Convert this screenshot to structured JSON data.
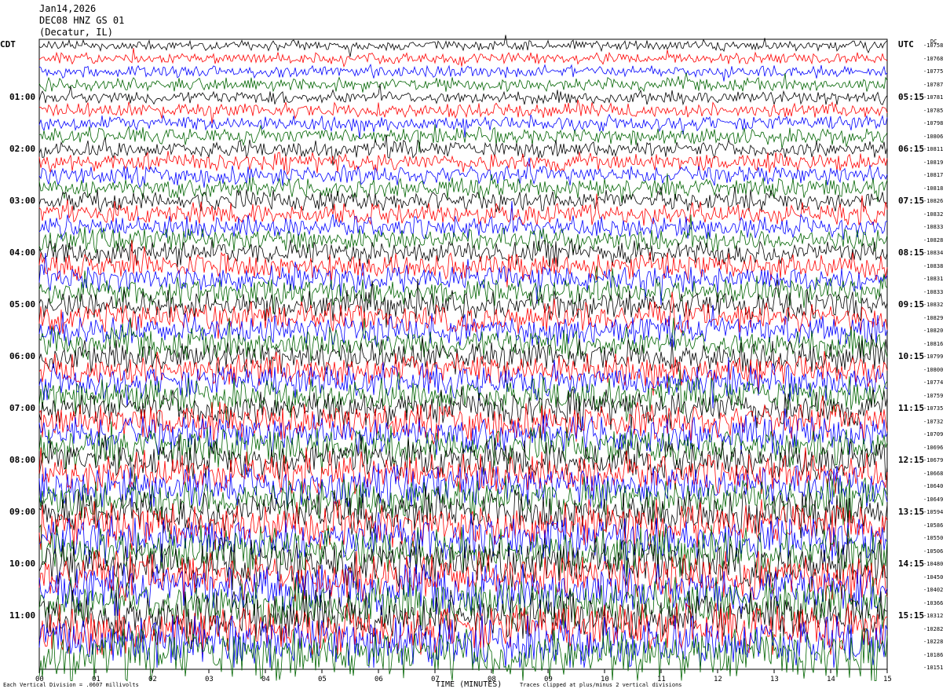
{
  "header": {
    "date": "Jan14,2026",
    "station": "DEC08 HNZ GS 01",
    "location": "(Decatur, IL)"
  },
  "left_axis_title": "CDT",
  "right_axis_title": "UTC",
  "dc_title": "DC",
  "footer": {
    "scale_note": "Each Vertical Division = .0607 millivolts",
    "x_axis_title": "TIME (MINUTES)",
    "clip_note": "Traces clipped at plus/minus 2 vertical divisions"
  },
  "colors": {
    "black": "#000000",
    "red": "#ff0000",
    "blue": "#0000ff",
    "green": "#006400"
  },
  "chart_data": {
    "type": "line",
    "title": "",
    "xlabel": "TIME (MINUTES)",
    "x_ticks": [
      "00",
      "01",
      "02",
      "03",
      "04",
      "05",
      "06",
      "07",
      "08",
      "09",
      "10",
      "11",
      "12",
      "13",
      "14",
      "15"
    ],
    "xlim": [
      0,
      15
    ],
    "trace_minutes": 15,
    "trace_count": 48,
    "trace_color_cycle": [
      "black",
      "red",
      "blue",
      "green"
    ],
    "left_ticks": [
      "01:00",
      "02:00",
      "03:00",
      "04:00",
      "05:00",
      "06:00",
      "07:00",
      "08:00",
      "09:00",
      "10:00",
      "11:00"
    ],
    "right_ticks": [
      "05:15",
      "06:15",
      "07:15",
      "08:15",
      "09:15",
      "10:15",
      "11:15",
      "12:15",
      "13:15",
      "14:15",
      "15:15"
    ],
    "dc_offsets": [
      "-10758",
      "-10768",
      "-10775",
      "-10787",
      "-10781",
      "-10785",
      "-10798",
      "-10806",
      "-10811",
      "-10819",
      "-10817",
      "-10818",
      "-10826",
      "-10832",
      "-10833",
      "-10828",
      "-10834",
      "-10838",
      "-10831",
      "-10833",
      "-10832",
      "-10829",
      "-10820",
      "-10816",
      "-10799",
      "-10800",
      "-10774",
      "-10759",
      "-10735",
      "-10732",
      "-10709",
      "-10696",
      "-10679",
      "-10668",
      "-10640",
      "-10649",
      "-10594",
      "-10586",
      "-10550",
      "-10506",
      "-10480",
      "-10450",
      "-10402",
      "-10366",
      "-10312",
      "-10282",
      "-10228",
      "-10186",
      "-10151"
    ],
    "amplitude_note": "relative noise amplitude increases toward later traces"
  }
}
